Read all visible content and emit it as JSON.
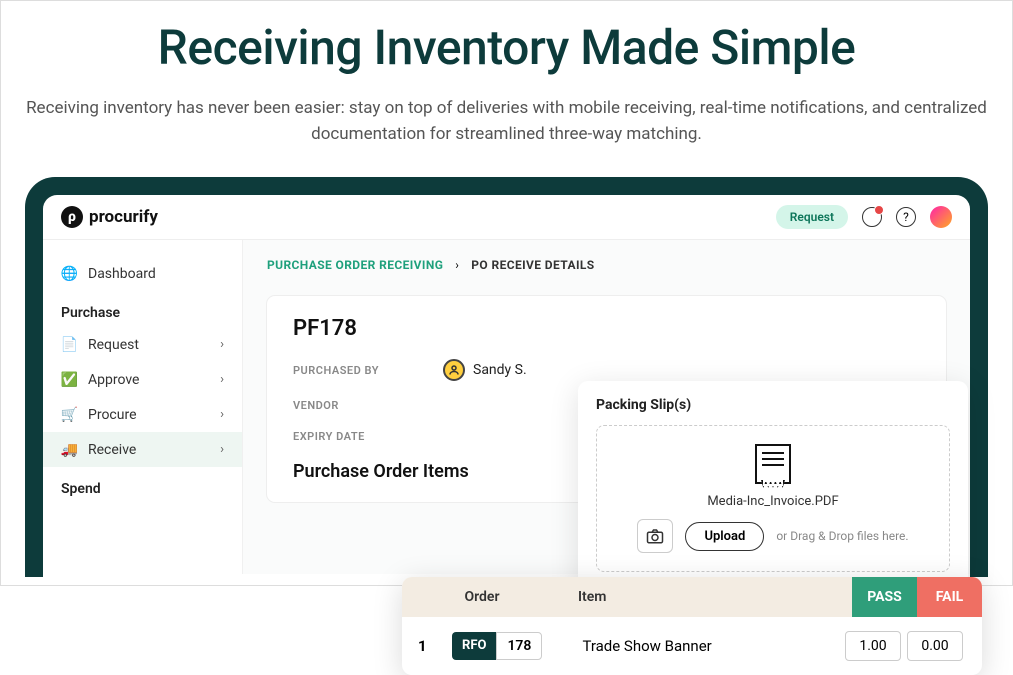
{
  "hero": {
    "title": "Receiving Inventory Made Simple",
    "subtitle": "Receiving inventory has never been easier: stay on top of deliveries with mobile receiving, real-time notifications, and centralized documentation for streamlined three-way matching."
  },
  "logo": "procurify",
  "topbar": {
    "request_btn": "Request"
  },
  "sidebar": {
    "dashboard": "Dashboard",
    "purchase_heading": "Purchase",
    "items": [
      {
        "label": "Request"
      },
      {
        "label": "Approve"
      },
      {
        "label": "Procure"
      },
      {
        "label": "Receive"
      }
    ],
    "spend_heading": "Spend"
  },
  "breadcrumb": {
    "a": "PURCHASE ORDER RECEIVING",
    "b": "PO RECEIVE DETAILS"
  },
  "doc": {
    "id": "PF178",
    "purchased_by_label": "PURCHASED BY",
    "purchased_by": "Sandy S.",
    "vendor_label": "VENDOR",
    "expiry_label": "EXPIRY DATE",
    "items_title": "Purchase Order Items"
  },
  "packing": {
    "title": "Packing Slip(s)",
    "file": "Media-Inc_Invoice.PDF",
    "upload": "Upload",
    "hint": "or Drag & Drop files here."
  },
  "order": {
    "col_order": "Order",
    "col_item": "Item",
    "pass": "PASS",
    "fail": "FAIL",
    "row_num": "1",
    "rfo": "RFO",
    "rfo_num": "178",
    "item_name": "Trade Show Banner",
    "pass_qty": "1.00",
    "fail_qty": "0.00"
  }
}
